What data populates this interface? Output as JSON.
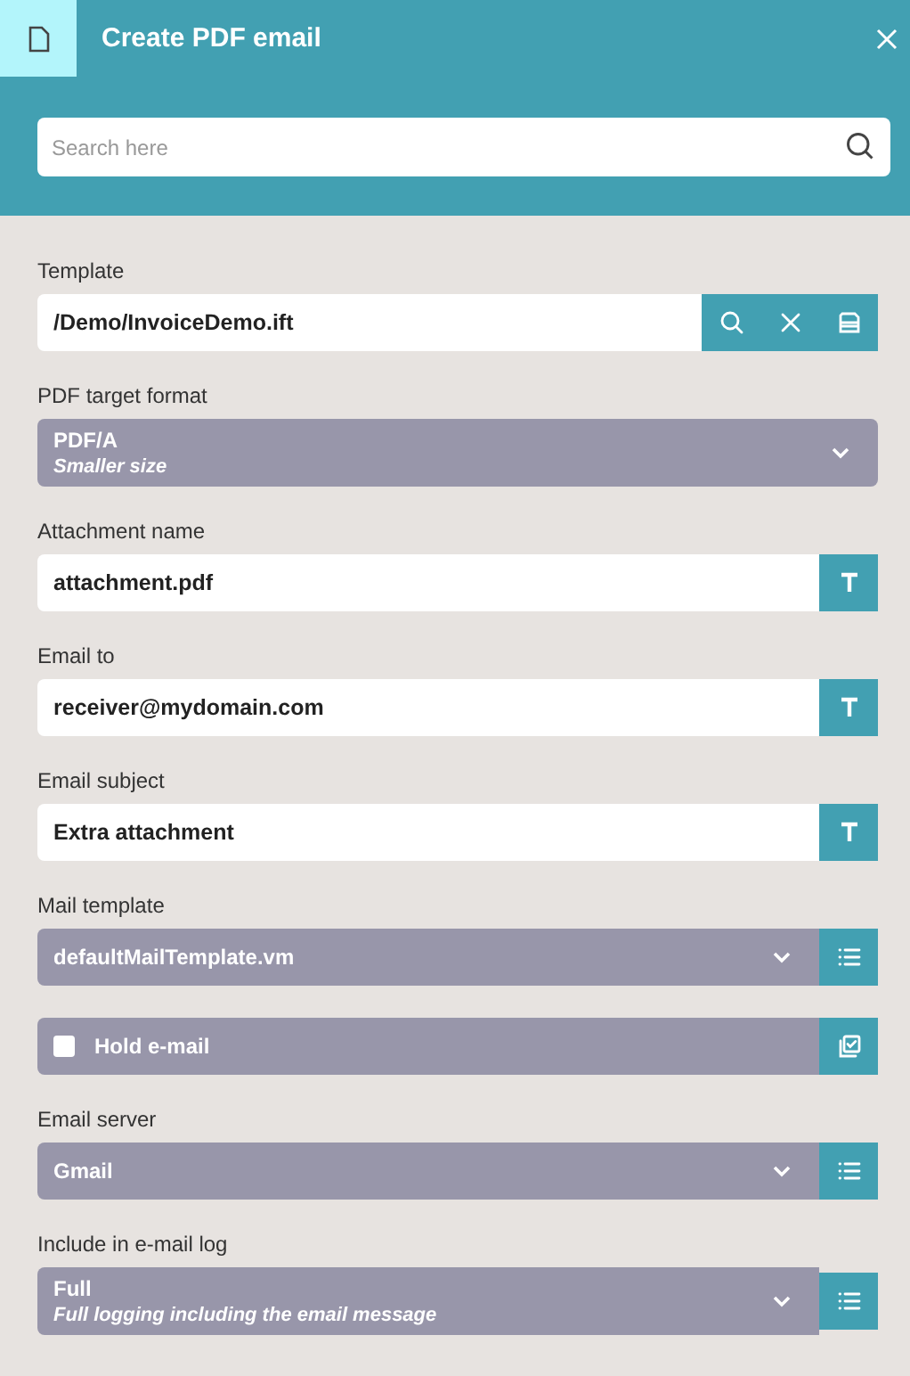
{
  "window": {
    "title": "Create PDF email"
  },
  "search": {
    "placeholder": "Search here"
  },
  "fields": [
    {
      "kind": "text",
      "label": "Template",
      "value": "/Demo/InvoiceDemo.ift",
      "actions": [
        {
          "kind": "search"
        },
        {
          "kind": "clear"
        },
        {
          "kind": "stamp"
        }
      ]
    },
    {
      "kind": "select",
      "label": "PDF target format",
      "value": "PDF/A",
      "description": "Smaller size"
    },
    {
      "kind": "text",
      "label": "Attachment name",
      "value": "attachment.pdf",
      "actions": [
        {
          "kind": "text"
        }
      ]
    },
    {
      "kind": "text",
      "label": "Email to",
      "value": "receiver@mydomain.com",
      "actions": [
        {
          "kind": "text"
        }
      ]
    },
    {
      "kind": "text",
      "label": "Email subject",
      "value": "Extra attachment",
      "actions": [
        {
          "kind": "text"
        }
      ]
    },
    {
      "kind": "select",
      "label": "Mail template",
      "value": "defaultMailTemplate.vm",
      "actions": [
        {
          "kind": "list"
        }
      ]
    },
    {
      "kind": "checkbox",
      "value": "Hold e-mail",
      "checked": false,
      "actions": [
        {
          "kind": "checklist"
        }
      ]
    },
    {
      "kind": "select",
      "label": "Email server",
      "value": "Gmail",
      "actions": [
        {
          "kind": "list"
        }
      ]
    },
    {
      "kind": "select",
      "label": "Include in e-mail log",
      "value": "Full",
      "description": "Full logging including the email message",
      "actions": [
        {
          "kind": "list"
        }
      ]
    }
  ]
}
